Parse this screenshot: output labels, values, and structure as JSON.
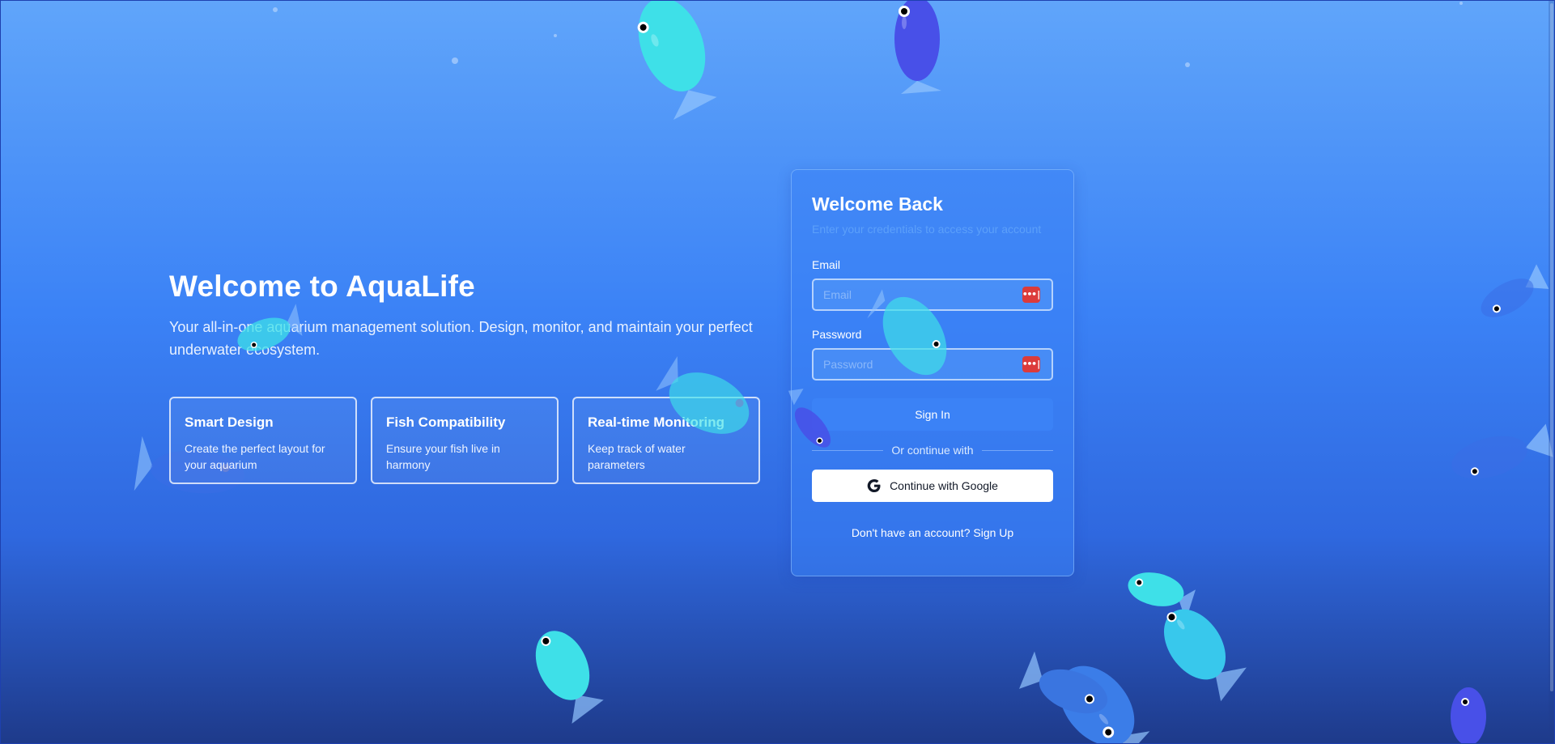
{
  "hero": {
    "title": "Welcome to AquaLife",
    "subtitle": "Your all-in-one aquarium management solution. Design, monitor, and maintain your perfect underwater ecosystem.",
    "features": [
      {
        "title": "Smart Design",
        "description": "Create the perfect layout for your aquarium"
      },
      {
        "title": "Fish Compatibility",
        "description": "Ensure your fish live in harmony"
      },
      {
        "title": "Real-time Monitoring",
        "description": "Keep track of water parameters"
      }
    ]
  },
  "login": {
    "title": "Welcome Back",
    "subtitle": "Enter your credentials to access your account",
    "email_label": "Email",
    "email_placeholder": "Email",
    "password_label": "Password",
    "password_placeholder": "Password",
    "password_manager_badge": "•••|",
    "sign_in_label": "Sign In",
    "divider_text": "Or continue with",
    "google_label": "Continue with Google",
    "signup_prompt": "Don't have an account?",
    "signup_link": "Sign Up"
  },
  "icons": {
    "password_manager": "password-manager-icon",
    "google": "google-logo-icon",
    "background_fish": "fish-icon",
    "bubbles": "bubble-icon"
  },
  "colors": {
    "background_top": "#60a5fa",
    "background_bottom": "#1e3a8a",
    "primary_button": "#3b82f6",
    "password_badge": "#dc3b3b",
    "fish_cyan": "#3ee0e8",
    "fish_blue": "#4850e8",
    "fish_pale": "#60a5fa"
  }
}
